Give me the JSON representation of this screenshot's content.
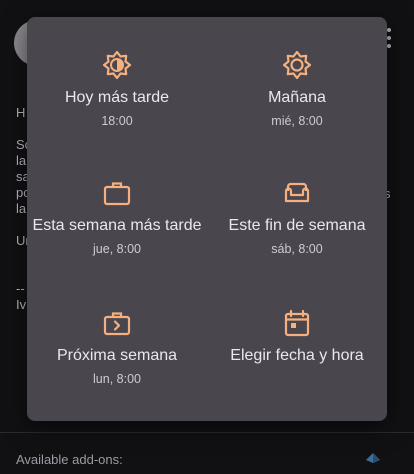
{
  "background": {
    "lines": [
      "H",
      "Sc",
      "la",
      "sa",
      "pc",
      "la",
      "Ur",
      "--",
      "Iv"
    ],
    "right_fragment": "s",
    "addons_label": "Available add-ons:"
  },
  "snooze_menu": {
    "accent_color": "#f6b07f",
    "options": [
      {
        "label": "Hoy más tarde",
        "time": "18:00",
        "icon": "brightness-icon"
      },
      {
        "label": "Mañana",
        "time": "mié, 8:00",
        "icon": "sun-gear-icon"
      },
      {
        "label": "Esta semana más tarde",
        "time": "jue, 8:00",
        "icon": "briefcase-icon"
      },
      {
        "label": "Este fin de semana",
        "time": "sáb, 8:00",
        "icon": "sofa-icon"
      },
      {
        "label": "Próxima semana",
        "time": "lun, 8:00",
        "icon": "next-week-icon"
      },
      {
        "label": "Elegir fecha y hora",
        "time": "",
        "icon": "calendar-icon"
      }
    ]
  }
}
